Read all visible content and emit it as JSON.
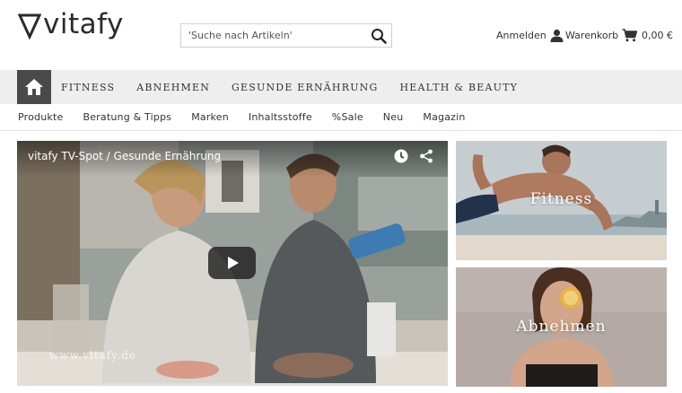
{
  "brand": {
    "name": "vitafy"
  },
  "search": {
    "placeholder": "Suche nach Artikeln",
    "value": "'Suche nach Artikeln'"
  },
  "account": {
    "login_label": "Anmelden",
    "cart_label": "Warenkorb",
    "cart_total": "0,00 €"
  },
  "main_nav": {
    "items": [
      {
        "label": "FITNESS"
      },
      {
        "label": "ABNEHMEN"
      },
      {
        "label": "GESUNDE ERNÄHRUNG"
      },
      {
        "label": "HEALTH & BEAUTY"
      }
    ]
  },
  "sub_nav": {
    "items": [
      {
        "label": "Produkte"
      },
      {
        "label": "Beratung & Tipps"
      },
      {
        "label": "Marken"
      },
      {
        "label": "Inhaltsstoffe"
      },
      {
        "label": "%Sale"
      },
      {
        "label": "Neu"
      },
      {
        "label": "Magazin"
      }
    ]
  },
  "video": {
    "title": "vitafy TV-Spot / Gesunde Ernährung",
    "watermark": "www.vitafy.de"
  },
  "tiles": [
    {
      "label": "Fitness"
    },
    {
      "label": "Abnehmen"
    }
  ],
  "icons": {
    "logo": "triangle-logo-icon",
    "search": "magnifier-icon",
    "login": "user-icon",
    "cart": "shopping-cart-icon",
    "home": "home-icon",
    "watch_later": "clock-icon",
    "share": "share-icon",
    "play": "play-icon"
  },
  "colors": {
    "text": "#333333",
    "nav_background": "#eeeeee",
    "home_button": "#4a4a4a",
    "play_button": "#1e1e1e"
  }
}
